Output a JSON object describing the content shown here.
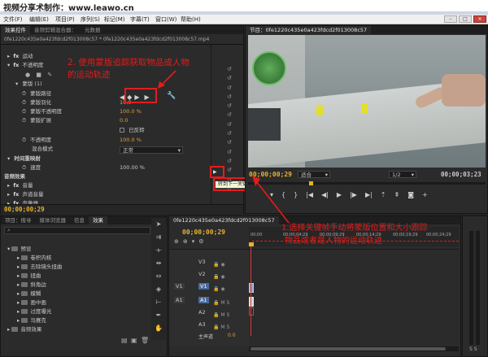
{
  "banner": {
    "text": "视频分享术制作：www.leawo.cn"
  },
  "menu": [
    "文件(F)",
    "编辑(E)",
    "项目(P)",
    "序列(S)",
    "标记(M)",
    "字幕(T)",
    "窗口(W)",
    "帮助(H)"
  ],
  "window_controls": {
    "minimize": "–",
    "maximize": "□",
    "close": "×"
  },
  "effect_controls": {
    "tabs": [
      "效果控件",
      "音频剪辑混合器：",
      "元数据"
    ],
    "clip_name": "0fe1220c435e0a423fdcd2f013008c57 * 0fe1220c435e0a423fdcd2f013008c57.mp4",
    "rows": {
      "motion": "运动",
      "opacity": "不透明度",
      "mask": "蒙版 (1)",
      "mask_path": "蒙版路径",
      "feather": "蒙版羽化",
      "feather_val": "10.0",
      "mask_opacity": "蒙版不透明度",
      "mask_opacity_val": "100.0 %",
      "expand": "蒙版扩展",
      "expand_val": "0.0",
      "inverted": "已反转",
      "opacity2": "不透明度",
      "opacity2_val": "100.0 %",
      "blend": "混合模式",
      "blend_val": "正常",
      "time_remap": "时间重映射",
      "speed": "速度",
      "speed_val": "100.00 %",
      "audio_effects": "音频效果",
      "volume": "音量",
      "channel": "声道音量",
      "panner": "声像器"
    },
    "timecode": "00;00;00;29",
    "tooltip": "转到下一关键帧"
  },
  "program_monitor": {
    "tab": "节目：0fe1220c435e0a423fdcd2f013008c57",
    "timecode": "00;00;00;29",
    "fit": "适合",
    "ratio": "1/2",
    "duration": "00;00;03;23"
  },
  "project_panel": {
    "tabs": [
      "项目：搜寻",
      "媒体浏览器",
      "信息",
      "效果"
    ],
    "folders": [
      "预设",
      "卷积内核",
      "去除镜头扭曲",
      "扭曲",
      "斜角边",
      "模糊",
      "画中画",
      "过度曝光",
      "马赛克",
      "音频效果"
    ]
  },
  "timeline": {
    "tab": "0fe1220c435e0a423fdcd2f013008c57",
    "timecode": "00;00;00;29",
    "ruler": [
      "00;00",
      "00;00;04;29",
      "00;00;09;29",
      "00;00;14;29",
      "00;00;19;29",
      "00;00;24;29"
    ],
    "video_tracks": [
      "V3",
      "V2",
      "V1"
    ],
    "audio_tracks": [
      "A1",
      "A2",
      "A3"
    ],
    "source_v": "V1",
    "source_a": "A1",
    "master": "主声道",
    "master_val": "0.0"
  },
  "annotations": {
    "note2_line1": "2. 使用蒙版追踪获取物品或人物",
    "note2_line2": "的运动轨迹",
    "note1_line1": "1.选择关键帧手动将蒙版位置和大小跟踪",
    "note1_line2": "物品或者是人物的运动轨迹"
  },
  "colors": {
    "annotation": "#e31c1c",
    "timecode": "#e8b22d",
    "playhead": "#d63c3c"
  }
}
